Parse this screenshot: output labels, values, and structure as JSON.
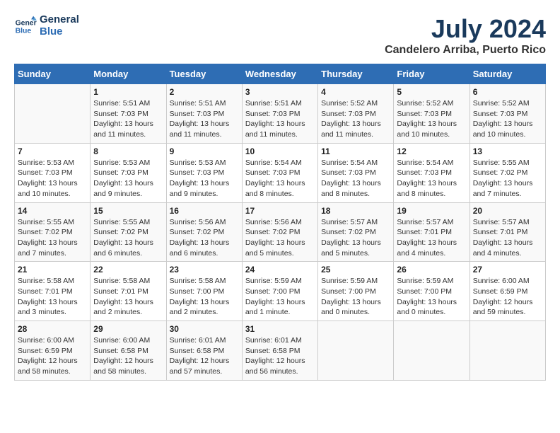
{
  "logo": {
    "line1": "General",
    "line2": "Blue"
  },
  "title": "July 2024",
  "location": "Candelero Arriba, Puerto Rico",
  "headers": [
    "Sunday",
    "Monday",
    "Tuesday",
    "Wednesday",
    "Thursday",
    "Friday",
    "Saturday"
  ],
  "weeks": [
    [
      {
        "day": "",
        "info": ""
      },
      {
        "day": "1",
        "info": "Sunrise: 5:51 AM\nSunset: 7:03 PM\nDaylight: 13 hours\nand 11 minutes."
      },
      {
        "day": "2",
        "info": "Sunrise: 5:51 AM\nSunset: 7:03 PM\nDaylight: 13 hours\nand 11 minutes."
      },
      {
        "day": "3",
        "info": "Sunrise: 5:51 AM\nSunset: 7:03 PM\nDaylight: 13 hours\nand 11 minutes."
      },
      {
        "day": "4",
        "info": "Sunrise: 5:52 AM\nSunset: 7:03 PM\nDaylight: 13 hours\nand 11 minutes."
      },
      {
        "day": "5",
        "info": "Sunrise: 5:52 AM\nSunset: 7:03 PM\nDaylight: 13 hours\nand 10 minutes."
      },
      {
        "day": "6",
        "info": "Sunrise: 5:52 AM\nSunset: 7:03 PM\nDaylight: 13 hours\nand 10 minutes."
      }
    ],
    [
      {
        "day": "7",
        "info": "Sunrise: 5:53 AM\nSunset: 7:03 PM\nDaylight: 13 hours\nand 10 minutes."
      },
      {
        "day": "8",
        "info": "Sunrise: 5:53 AM\nSunset: 7:03 PM\nDaylight: 13 hours\nand 9 minutes."
      },
      {
        "day": "9",
        "info": "Sunrise: 5:53 AM\nSunset: 7:03 PM\nDaylight: 13 hours\nand 9 minutes."
      },
      {
        "day": "10",
        "info": "Sunrise: 5:54 AM\nSunset: 7:03 PM\nDaylight: 13 hours\nand 8 minutes."
      },
      {
        "day": "11",
        "info": "Sunrise: 5:54 AM\nSunset: 7:03 PM\nDaylight: 13 hours\nand 8 minutes."
      },
      {
        "day": "12",
        "info": "Sunrise: 5:54 AM\nSunset: 7:03 PM\nDaylight: 13 hours\nand 8 minutes."
      },
      {
        "day": "13",
        "info": "Sunrise: 5:55 AM\nSunset: 7:02 PM\nDaylight: 13 hours\nand 7 minutes."
      }
    ],
    [
      {
        "day": "14",
        "info": "Sunrise: 5:55 AM\nSunset: 7:02 PM\nDaylight: 13 hours\nand 7 minutes."
      },
      {
        "day": "15",
        "info": "Sunrise: 5:55 AM\nSunset: 7:02 PM\nDaylight: 13 hours\nand 6 minutes."
      },
      {
        "day": "16",
        "info": "Sunrise: 5:56 AM\nSunset: 7:02 PM\nDaylight: 13 hours\nand 6 minutes."
      },
      {
        "day": "17",
        "info": "Sunrise: 5:56 AM\nSunset: 7:02 PM\nDaylight: 13 hours\nand 5 minutes."
      },
      {
        "day": "18",
        "info": "Sunrise: 5:57 AM\nSunset: 7:02 PM\nDaylight: 13 hours\nand 5 minutes."
      },
      {
        "day": "19",
        "info": "Sunrise: 5:57 AM\nSunset: 7:01 PM\nDaylight: 13 hours\nand 4 minutes."
      },
      {
        "day": "20",
        "info": "Sunrise: 5:57 AM\nSunset: 7:01 PM\nDaylight: 13 hours\nand 4 minutes."
      }
    ],
    [
      {
        "day": "21",
        "info": "Sunrise: 5:58 AM\nSunset: 7:01 PM\nDaylight: 13 hours\nand 3 minutes."
      },
      {
        "day": "22",
        "info": "Sunrise: 5:58 AM\nSunset: 7:01 PM\nDaylight: 13 hours\nand 2 minutes."
      },
      {
        "day": "23",
        "info": "Sunrise: 5:58 AM\nSunset: 7:00 PM\nDaylight: 13 hours\nand 2 minutes."
      },
      {
        "day": "24",
        "info": "Sunrise: 5:59 AM\nSunset: 7:00 PM\nDaylight: 13 hours\nand 1 minute."
      },
      {
        "day": "25",
        "info": "Sunrise: 5:59 AM\nSunset: 7:00 PM\nDaylight: 13 hours\nand 0 minutes."
      },
      {
        "day": "26",
        "info": "Sunrise: 5:59 AM\nSunset: 7:00 PM\nDaylight: 13 hours\nand 0 minutes."
      },
      {
        "day": "27",
        "info": "Sunrise: 6:00 AM\nSunset: 6:59 PM\nDaylight: 12 hours\nand 59 minutes."
      }
    ],
    [
      {
        "day": "28",
        "info": "Sunrise: 6:00 AM\nSunset: 6:59 PM\nDaylight: 12 hours\nand 58 minutes."
      },
      {
        "day": "29",
        "info": "Sunrise: 6:00 AM\nSunset: 6:58 PM\nDaylight: 12 hours\nand 58 minutes."
      },
      {
        "day": "30",
        "info": "Sunrise: 6:01 AM\nSunset: 6:58 PM\nDaylight: 12 hours\nand 57 minutes."
      },
      {
        "day": "31",
        "info": "Sunrise: 6:01 AM\nSunset: 6:58 PM\nDaylight: 12 hours\nand 56 minutes."
      },
      {
        "day": "",
        "info": ""
      },
      {
        "day": "",
        "info": ""
      },
      {
        "day": "",
        "info": ""
      }
    ]
  ]
}
